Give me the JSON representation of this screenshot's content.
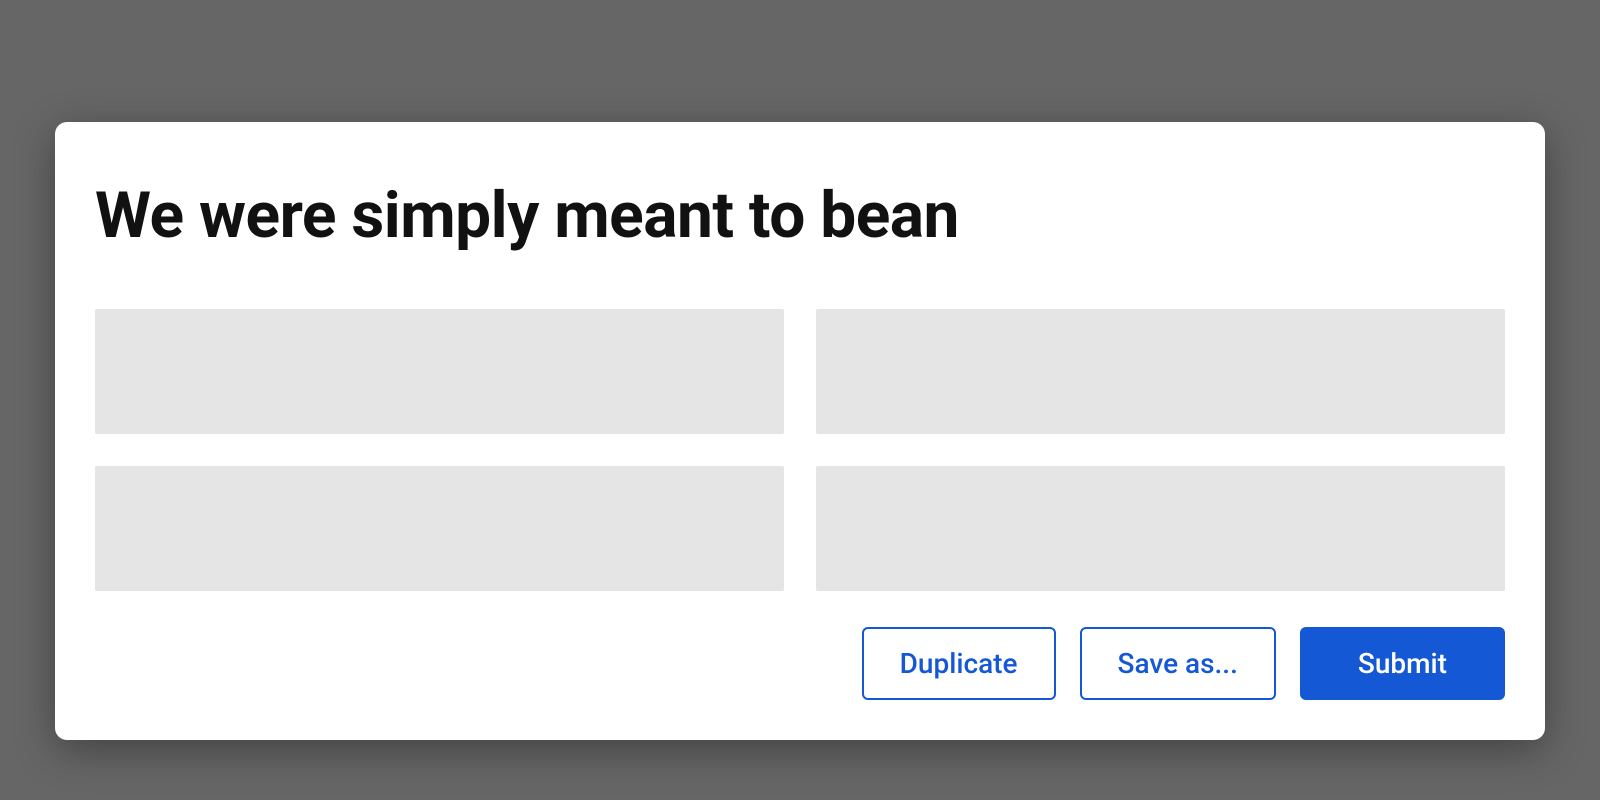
{
  "modal": {
    "title": "We were simply meant to bean",
    "actions": {
      "duplicate": "Duplicate",
      "save_as": "Save as...",
      "submit": "Submit"
    }
  }
}
